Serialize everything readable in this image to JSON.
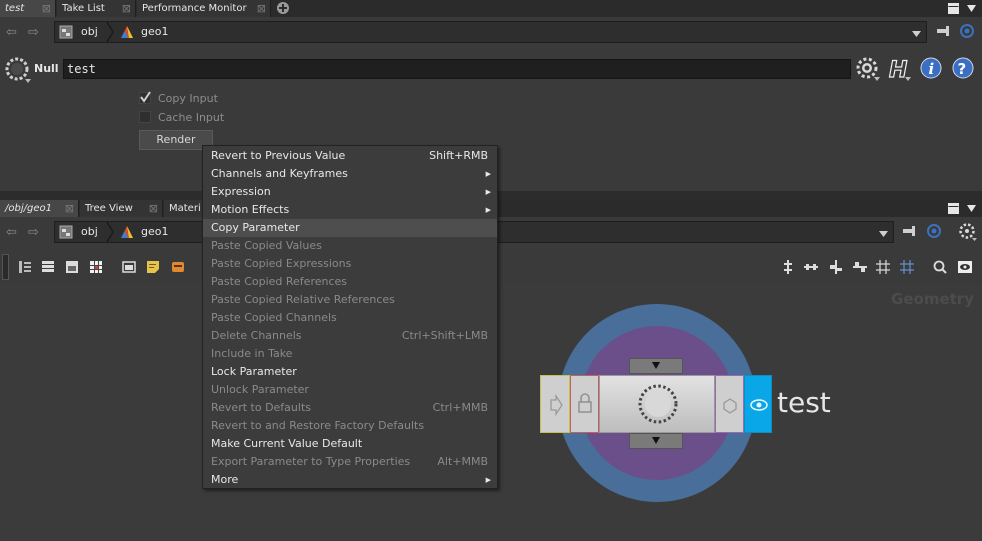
{
  "top_tabs": [
    {
      "label": "test"
    },
    {
      "label": "Take List"
    },
    {
      "label": "Performance Monitor"
    }
  ],
  "top_path": {
    "crumbs": [
      {
        "label": "obj"
      },
      {
        "label": "geo1"
      }
    ]
  },
  "param_header": {
    "node_type": "Null",
    "node_name": "test"
  },
  "params": {
    "copy_input_label": "Copy Input",
    "cache_input_label": "Cache Input",
    "render_label": "Render"
  },
  "bottom_tabs": [
    {
      "label": "/obj/geo1"
    },
    {
      "label": "Tree View"
    },
    {
      "label": "Materi"
    }
  ],
  "bottom_path": {
    "crumbs": [
      {
        "label": "obj"
      },
      {
        "label": "geo1"
      }
    ]
  },
  "network": {
    "context_label": "Geometry",
    "node_label": "test"
  },
  "context_menu": {
    "items": [
      {
        "label": "Revert to Previous Value",
        "shortcut": "Shift+RMB",
        "enabled": true
      },
      {
        "label": "Channels and Keyframes",
        "submenu": true,
        "enabled": true
      },
      {
        "label": "Expression",
        "submenu": true,
        "enabled": true
      },
      {
        "label": "Motion Effects",
        "submenu": true,
        "enabled": true
      },
      {
        "label": "Copy Parameter",
        "enabled": true,
        "highlighted": true
      },
      {
        "label": "Paste Copied Values",
        "enabled": false
      },
      {
        "label": "Paste Copied Expressions",
        "enabled": false
      },
      {
        "label": "Paste Copied References",
        "enabled": false
      },
      {
        "label": "Paste Copied Relative References",
        "enabled": false
      },
      {
        "label": "Paste Copied Channels",
        "enabled": false
      },
      {
        "label": "Delete Channels",
        "shortcut": "Ctrl+Shift+LMB",
        "enabled": false
      },
      {
        "label": "Include in Take",
        "enabled": false
      },
      {
        "label": "Lock Parameter",
        "enabled": true
      },
      {
        "label": "Unlock Parameter",
        "enabled": false
      },
      {
        "label": "Revert to Defaults",
        "shortcut": "Ctrl+MMB",
        "enabled": false
      },
      {
        "label": "Revert to and Restore Factory Defaults",
        "enabled": false
      },
      {
        "label": "Make Current Value Default",
        "enabled": true
      },
      {
        "label": "Export Parameter to Type Properties",
        "shortcut": "Alt+MMB",
        "enabled": false
      },
      {
        "label": "More",
        "submenu": true,
        "enabled": true
      }
    ]
  },
  "colors": {
    "accent_blue": "#0aa7e8",
    "node_ring_outer": "#4a6e9a",
    "node_ring_inner": "#6a4f8a",
    "help_blue": "#3a6fc4"
  }
}
